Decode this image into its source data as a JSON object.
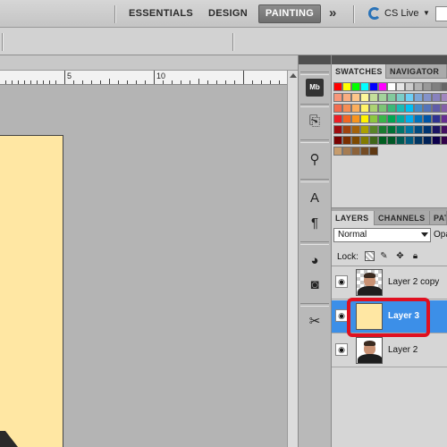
{
  "workspace_bar": {
    "items": [
      "ESSENTIALS",
      "DESIGN",
      "PAINTING"
    ],
    "active": "PAINTING",
    "more_icon": "double-chevron-right-icon",
    "cs_live": {
      "label": "CS Live",
      "icon": "cs-live-icon"
    }
  },
  "ruler": {
    "labels": [
      "5",
      "10"
    ]
  },
  "tools": [
    "mini-bridge-icon",
    "history-icon",
    "clone-source-icon",
    "character-icon",
    "paragraph-icon",
    "brush-preset-icon",
    "layer-mask-icon",
    "tool-presets-icon"
  ],
  "swatches_panel": {
    "tabs": [
      "SWATCHES",
      "NAVIGATOR"
    ],
    "active_tab": "SWATCHES",
    "rows": [
      [
        "#ff0000",
        "#ffff00",
        "#00ff00",
        "#00ffff",
        "#0000ff",
        "#ff00ff",
        "#ffffff",
        "#e5e5e5",
        "#cccccc",
        "#b2b2b2",
        "#999999",
        "#808080",
        "#666666"
      ],
      [
        "#f7977a",
        "#f9ad81",
        "#fdc68a",
        "#fff79a",
        "#c4df9b",
        "#a3d39c",
        "#82ca9d",
        "#7bcdc8",
        "#6ecff6",
        "#7ea7d8",
        "#8493ca",
        "#8882be",
        "#a187be"
      ],
      [
        "#f26c4f",
        "#f68e55",
        "#fbaf5c",
        "#fff467",
        "#acd372",
        "#7cc576",
        "#3bb878",
        "#1abbb4",
        "#00bff3",
        "#438cca",
        "#5574b9",
        "#605ca8",
        "#855fa8"
      ],
      [
        "#ed1c24",
        "#f26522",
        "#f7941d",
        "#fff200",
        "#8dc73f",
        "#39b54a",
        "#00a651",
        "#00a99d",
        "#00aeef",
        "#0072bc",
        "#0054a6",
        "#2e3192",
        "#662d91"
      ],
      [
        "#9e0b0f",
        "#a0410d",
        "#a36209",
        "#aba000",
        "#598527",
        "#1a7b30",
        "#007236",
        "#00746b",
        "#0076a3",
        "#004b80",
        "#003471",
        "#1b1464",
        "#440e62"
      ],
      [
        "#790000",
        "#7b2e00",
        "#7d4900",
        "#827b00",
        "#406618",
        "#005e20",
        "#005826",
        "#005952",
        "#005b7f",
        "#003663",
        "#002157",
        "#0d004c",
        "#32004b"
      ],
      [
        "#c69c6d",
        "#a67c52",
        "#8c6239",
        "#754c24",
        "#603913"
      ]
    ]
  },
  "layers_panel": {
    "tabs": [
      "LAYERS",
      "CHANNELS",
      "PATHS"
    ],
    "active_tab": "LAYERS",
    "blend_mode": "Normal",
    "opacity_label": "Opacity:",
    "lock_label": "Lock:",
    "lock_icons": [
      "lock-transparent-icon",
      "lock-paint-icon",
      "lock-position-icon",
      "lock-all-icon"
    ],
    "layers": [
      {
        "name": "Layer 2 copy",
        "thumbnail": "photo",
        "visible": true,
        "selected": false
      },
      {
        "name": "Layer 3",
        "thumbnail": "fill",
        "visible": true,
        "selected": true
      },
      {
        "name": "Layer 2",
        "thumbnail": "photo",
        "visible": true,
        "selected": false
      }
    ],
    "selected_color": "#3c8fe8",
    "highlight_color": "#e01020"
  },
  "canvas": {
    "fill_color": "#ffe7a3"
  }
}
